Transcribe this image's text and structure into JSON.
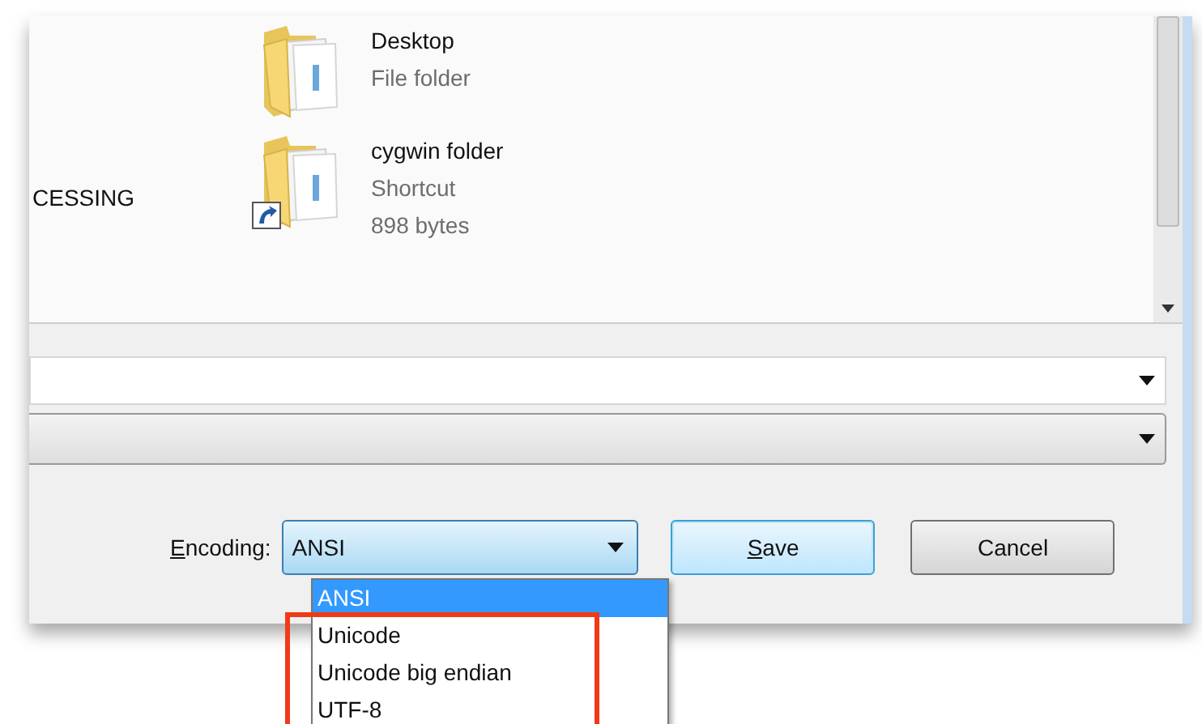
{
  "nav_items": [
    {
      "label": "CESSING"
    }
  ],
  "files": [
    {
      "name": "Desktop",
      "details": [
        "File folder"
      ],
      "shortcut": false
    },
    {
      "name": "cygwin folder",
      "details": [
        "Shortcut",
        "898 bytes"
      ],
      "shortcut": true
    }
  ],
  "encoding": {
    "label": "Encoding:",
    "mnemonic_underlined": true,
    "value": "ANSI",
    "options": [
      {
        "label": "ANSI",
        "selected": true,
        "highlighted": false
      },
      {
        "label": "Unicode",
        "selected": false,
        "highlighted": true
      },
      {
        "label": "Unicode big endian",
        "selected": false,
        "highlighted": true
      },
      {
        "label": "UTF-8",
        "selected": false,
        "highlighted": true
      }
    ]
  },
  "buttons": [
    {
      "label": "Save",
      "default": true,
      "mnemonic_underlined": true
    },
    {
      "label": "Cancel",
      "default": false,
      "mnemonic_underlined": false
    }
  ]
}
